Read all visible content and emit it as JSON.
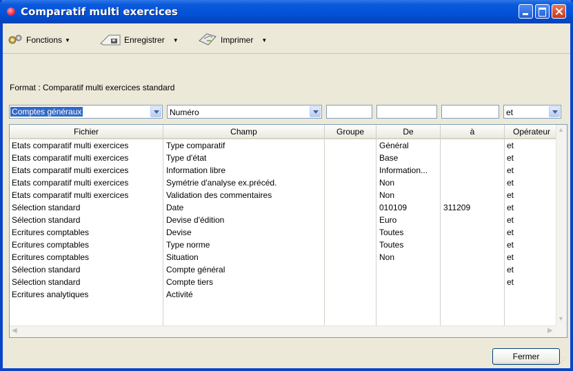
{
  "window": {
    "title": "Comparatif multi exercices"
  },
  "toolbar": {
    "fonctions": "Fonctions",
    "enregistrer": "Enregistrer",
    "imprimer": "Imprimer"
  },
  "format_label": "Format : Comparatif multi exercices standard",
  "filters": {
    "fichier": "Comptes généraux",
    "champ": "Numéro",
    "groupe": "",
    "de": "",
    "a": "",
    "operateur": "et"
  },
  "columns": [
    "Fichier",
    "Champ",
    "Groupe",
    "De",
    "à",
    "Opérateur"
  ],
  "rows": [
    [
      "Etats comparatif multi exercices",
      "Type comparatif",
      "",
      "Général",
      "",
      "et"
    ],
    [
      "Etats comparatif multi exercices",
      "Type d'état",
      "",
      "Base",
      "",
      "et"
    ],
    [
      "Etats comparatif multi exercices",
      "Information libre",
      "",
      "Information...",
      "",
      "et"
    ],
    [
      "Etats comparatif multi exercices",
      "Symétrie d'analyse ex.précéd.",
      "",
      "Non",
      "",
      "et"
    ],
    [
      "Etats comparatif multi exercices",
      "Validation des commentaires",
      "",
      "Non",
      "",
      "et"
    ],
    [
      "Sélection standard",
      "Date",
      "",
      "010109",
      "311209",
      "et"
    ],
    [
      "Sélection standard",
      "Devise d'édition",
      "",
      "Euro",
      "",
      "et"
    ],
    [
      "Ecritures comptables",
      "Devise",
      "",
      "Toutes",
      "",
      "et"
    ],
    [
      "Ecritures comptables",
      "Type norme",
      "",
      "Toutes",
      "",
      "et"
    ],
    [
      "Ecritures comptables",
      "Situation",
      "",
      "Non",
      "",
      "et"
    ],
    [
      "Sélection standard",
      "Compte général",
      "",
      "",
      "",
      "et"
    ],
    [
      "Sélection standard",
      "Compte tiers",
      "",
      "",
      "",
      "et"
    ],
    [
      "Ecritures analytiques",
      "Activité",
      "",
      "",
      "",
      ""
    ]
  ],
  "buttons": {
    "fermer": "Fermer"
  }
}
